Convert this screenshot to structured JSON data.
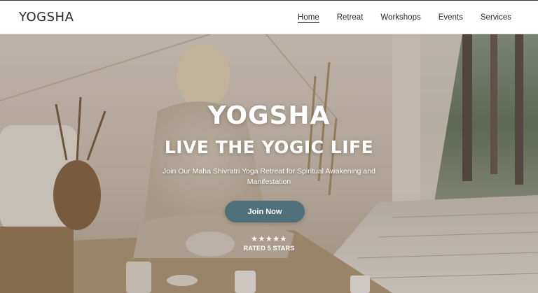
{
  "brand": {
    "logo_text": "YOGSHA"
  },
  "nav": {
    "items": [
      {
        "label": "Home",
        "active": true
      },
      {
        "label": "Retreat",
        "active": false
      },
      {
        "label": "Workshops",
        "active": false
      },
      {
        "label": "Events",
        "active": false
      },
      {
        "label": "Services",
        "active": false
      }
    ]
  },
  "hero": {
    "title": "YOGSHA",
    "subtitle": "LIVE THE YOGIC LIFE",
    "description": "Join Our Maha Shivratri Yoga Retreat for Spiritual Awakening and Manifestation",
    "cta_label": "Join Now",
    "stars": "★★★★★",
    "rating_text": "RATED 5 STARS",
    "rating_value": 5
  },
  "colors": {
    "accent_button": "#4f6f7a",
    "text_dark": "#2a2a2a",
    "hero_text": "#ffffff"
  }
}
